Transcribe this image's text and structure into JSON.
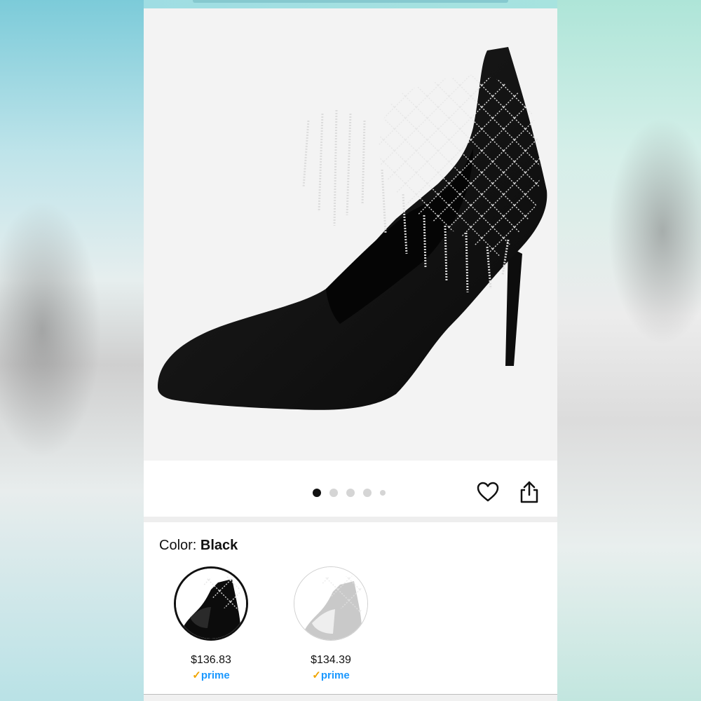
{
  "gallery": {
    "image_count": 5,
    "active_index": 0
  },
  "actions": {
    "favorite_icon": "heart-icon",
    "share_icon": "share-icon"
  },
  "color": {
    "label": "Color: ",
    "selected": "Black"
  },
  "options": [
    {
      "price": "$136.83",
      "badge_check": "✓",
      "badge": "prime"
    },
    {
      "price": "$134.39",
      "badge_check": "✓",
      "badge": "prime"
    }
  ],
  "colors": {
    "prime_blue": "#1a98ff",
    "prime_check": "#f0a400",
    "link": "#007185"
  }
}
